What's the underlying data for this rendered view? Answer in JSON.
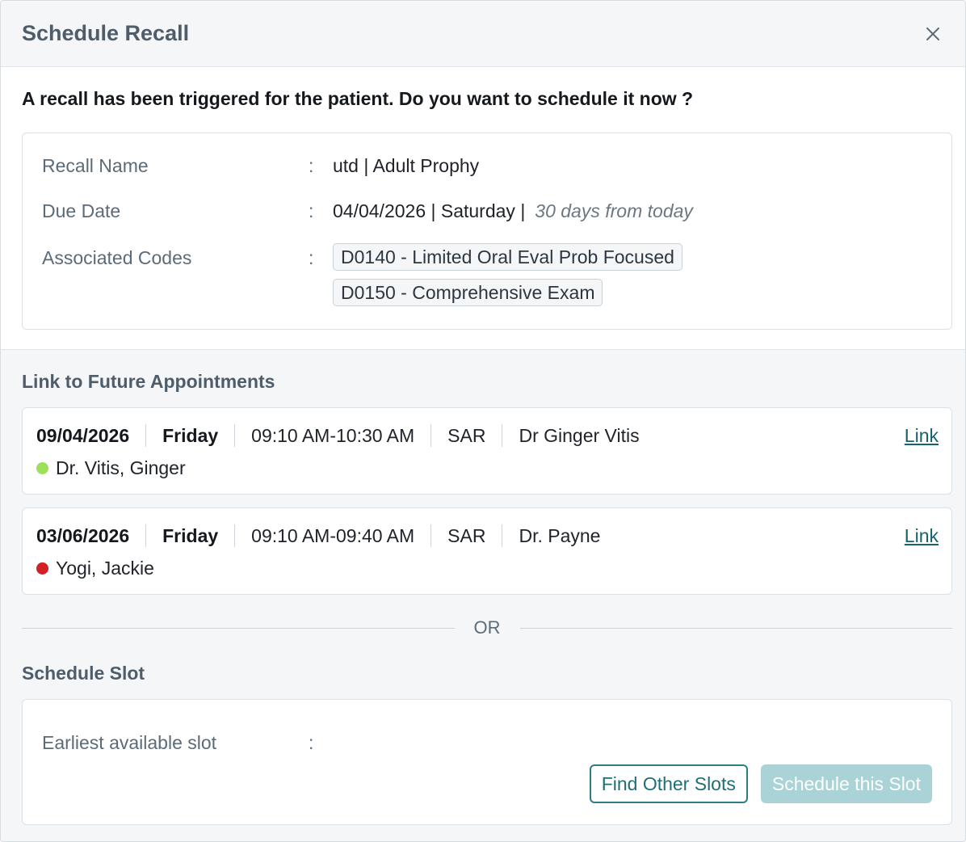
{
  "dialog": {
    "title": "Schedule Recall",
    "close_icon": "close-icon"
  },
  "prompt": "A recall has been triggered for the patient. Do you want to schedule it now ?",
  "recall": {
    "name_label": "Recall Name",
    "name_value": "utd | Adult Prophy",
    "due_label": "Due Date",
    "due_value": "04/04/2026 | Saturday |",
    "due_note": "30 days from today",
    "codes_label": "Associated Codes",
    "colon": ":",
    "codes": [
      "D0140 - Limited Oral Eval Prob Focused",
      "D0150 - Comprehensive Exam"
    ]
  },
  "future": {
    "title": "Link to Future Appointments",
    "link_label": "Link",
    "appointments": [
      {
        "date": "09/04/2026",
        "day": "Friday",
        "time": "09:10 AM-10:30 AM",
        "operatory": "SAR",
        "provider": "Dr Ginger Vitis",
        "patient": "Dr. Vitis, Ginger",
        "status_color": "#9be25a"
      },
      {
        "date": "03/06/2026",
        "day": "Friday",
        "time": "09:10 AM-09:40 AM",
        "operatory": "SAR",
        "provider": "Dr. Payne",
        "patient": "Yogi, Jackie",
        "status_color": "#d31f26"
      }
    ]
  },
  "divider": {
    "or_text": "OR"
  },
  "slot": {
    "title": "Schedule Slot",
    "earliest_label": "Earliest available slot",
    "colon": ":",
    "earliest_value": "",
    "find_other_label": "Find Other Slots",
    "schedule_label": "Schedule this Slot"
  },
  "colors": {
    "accent": "#2c7d84",
    "link": "#16636b",
    "disabled_button": "#a9d3d7",
    "title_gray": "#4f5d6b"
  }
}
